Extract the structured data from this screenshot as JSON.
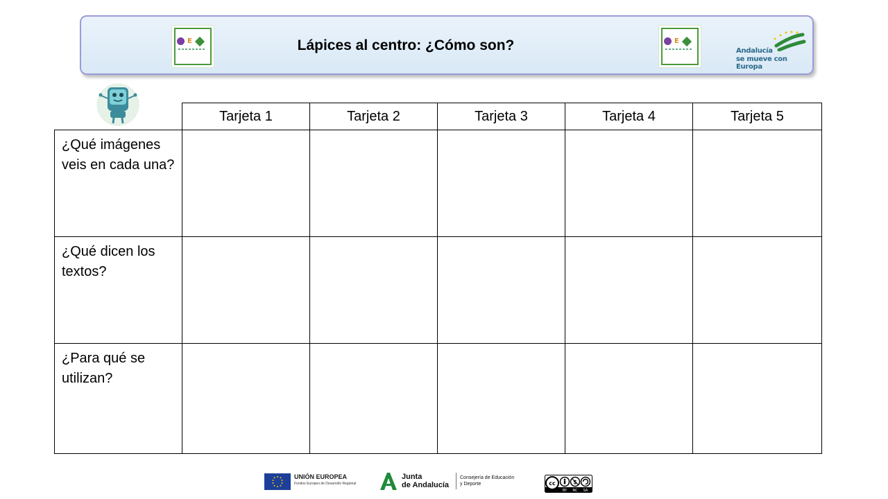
{
  "header": {
    "title": "Lápices al centro: ¿Cómo son?",
    "andalucia_line1": "Andalucía",
    "andalucia_line2": "se mueve con Europa"
  },
  "table": {
    "columns": [
      "Tarjeta 1",
      "Tarjeta 2",
      "Tarjeta 3",
      "Tarjeta 4",
      "Tarjeta 5"
    ],
    "rows": [
      "¿Qué imágenes veis en cada una?",
      "¿Qué dicen los textos?",
      "¿Para qué se utilizan?"
    ]
  },
  "footer": {
    "eu_title": "UNIÓN EUROPEA",
    "eu_subtitle": "Fondos Europeo de Desarrollo Regional",
    "junta_line1": "Junta",
    "junta_line2": "de Andalucía",
    "consejeria_line1": "Consejería de Educación",
    "consejeria_line2": "y Deporte",
    "license_labels": [
      "BY",
      "NC",
      "SA"
    ]
  },
  "colors": {
    "banner_border": "#9b9bd8",
    "banner_bg": "#dfeef9",
    "logo_green": "#4a9a3a",
    "logo_purple": "#7b3fa0"
  }
}
